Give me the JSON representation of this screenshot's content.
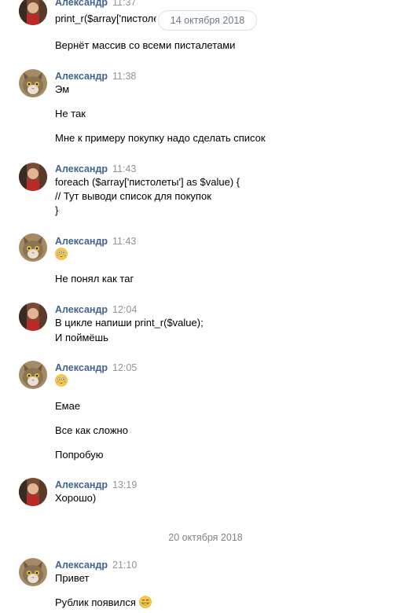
{
  "date_pill": "14 октября 2018",
  "date_separator": "20 октября 2018",
  "colors": {
    "author": "#42648b",
    "time": "#939393",
    "date_text": "#828282"
  },
  "messages": [
    {
      "avatar": "person",
      "author": "Александр",
      "time": "11:37",
      "lines": [
        "print_r($array['пистолеты']);",
        "Вернёт массив со всеми пистaлетами"
      ]
    },
    {
      "avatar": "cat",
      "author": "Александр",
      "time": "11:38",
      "lines": [
        "Эм",
        "Не так",
        "Мне к примеру покупку надо сделать список"
      ]
    },
    {
      "avatar": "person",
      "author": "Александр",
      "time": "11:43",
      "lines": [
        "foreach ($array['пистолеты'] as $value) {",
        "// Тут выводи список для покупок",
        "}"
      ]
    },
    {
      "avatar": "cat",
      "author": "Александр",
      "time": "11:43",
      "lines": [
        "flushed-emoji",
        "Не понял как таг"
      ]
    },
    {
      "avatar": "person",
      "author": "Александр",
      "time": "12:04",
      "lines": [
        "В цикле напиши print_r($value);",
        "И поймёшь"
      ]
    },
    {
      "avatar": "cat",
      "author": "Александр",
      "time": "12:05",
      "lines": [
        "flushed-emoji",
        "Емае",
        "Все как сложно",
        "Попробую"
      ]
    },
    {
      "avatar": "person",
      "author": "Александр",
      "time": "13:19",
      "lines": [
        "Хорошо)"
      ]
    },
    {
      "avatar": "cat",
      "author": "Александр",
      "time": "21:10",
      "lines": [
        "Привет",
        "Рублик появился",
        "grinning-emoji"
      ]
    }
  ]
}
